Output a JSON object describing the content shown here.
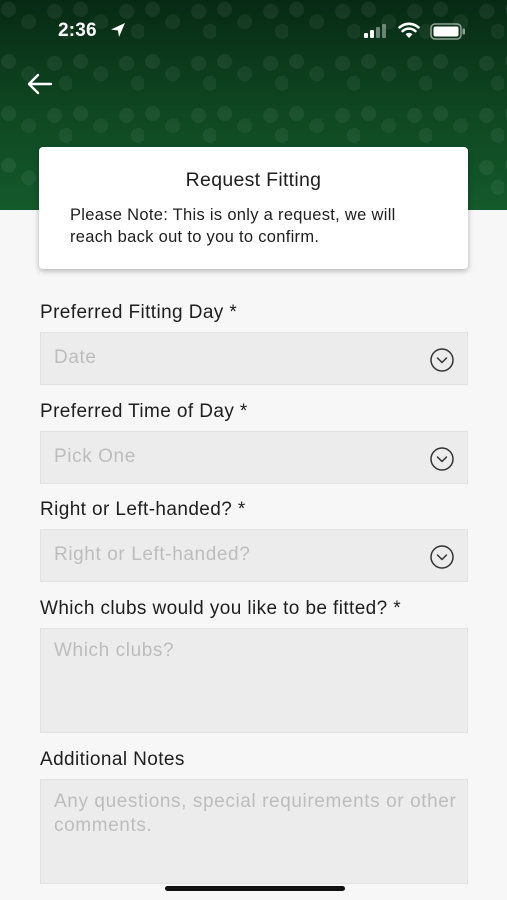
{
  "status_bar": {
    "time": "2:36",
    "icons": [
      "location-arrow-icon",
      "cellular-signal-icon",
      "wifi-icon",
      "battery-icon"
    ]
  },
  "header": {
    "back_icon": "arrow-left-icon",
    "brand_color": "#0f4822"
  },
  "card": {
    "title": "Request Fitting",
    "note": "Please Note: This is only a request, we will reach back out to you to confirm."
  },
  "form": {
    "fitting_day": {
      "label": "Preferred Fitting Day *",
      "placeholder": "Date",
      "icon": "chevron-down-circle-icon"
    },
    "time_of_day": {
      "label": "Preferred Time of Day *",
      "placeholder": "Pick One",
      "icon": "chevron-down-circle-icon"
    },
    "handedness": {
      "label": "Right or Left-handed? *",
      "placeholder": "Right or Left-handed?",
      "icon": "chevron-down-circle-icon"
    },
    "clubs": {
      "label": "Which clubs would you like to be fitted? *",
      "placeholder": "Which clubs?"
    },
    "notes": {
      "label": "Additional Notes",
      "placeholder": "Any questions, special requirements or other comments."
    }
  }
}
